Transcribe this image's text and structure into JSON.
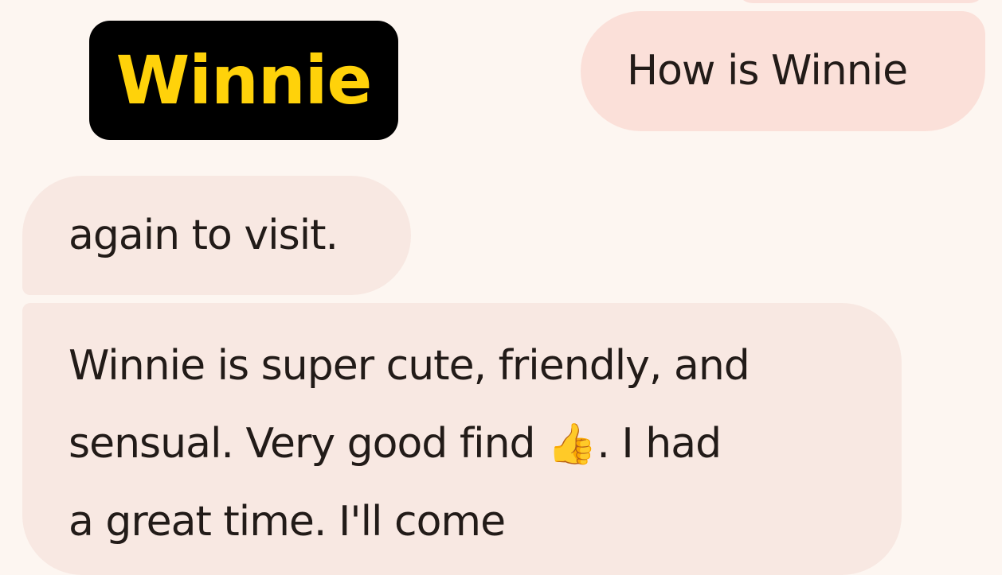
{
  "header": {
    "contact_label": "Winnie",
    "label_colors": {
      "background": "#000000",
      "text": "#ffd20a"
    }
  },
  "messages": [
    {
      "direction": "outgoing",
      "text": "How is Winnie"
    },
    {
      "direction": "incoming",
      "text": "again to visit."
    },
    {
      "direction": "incoming",
      "line1": "Winnie is super cute, friendly, and",
      "line2_before": "sensual. Very good find",
      "line2_emoji": "👍",
      "line2_after": ". I had",
      "line3": "a great time. I'll come"
    }
  ],
  "colors": {
    "background": "#fdf6f1",
    "outgoing_bubble": "#fbe0d9",
    "incoming_bubble": "#f8e8e2",
    "text": "#221b18"
  },
  "icons": {
    "emoji": "thumbs-up-icon"
  }
}
